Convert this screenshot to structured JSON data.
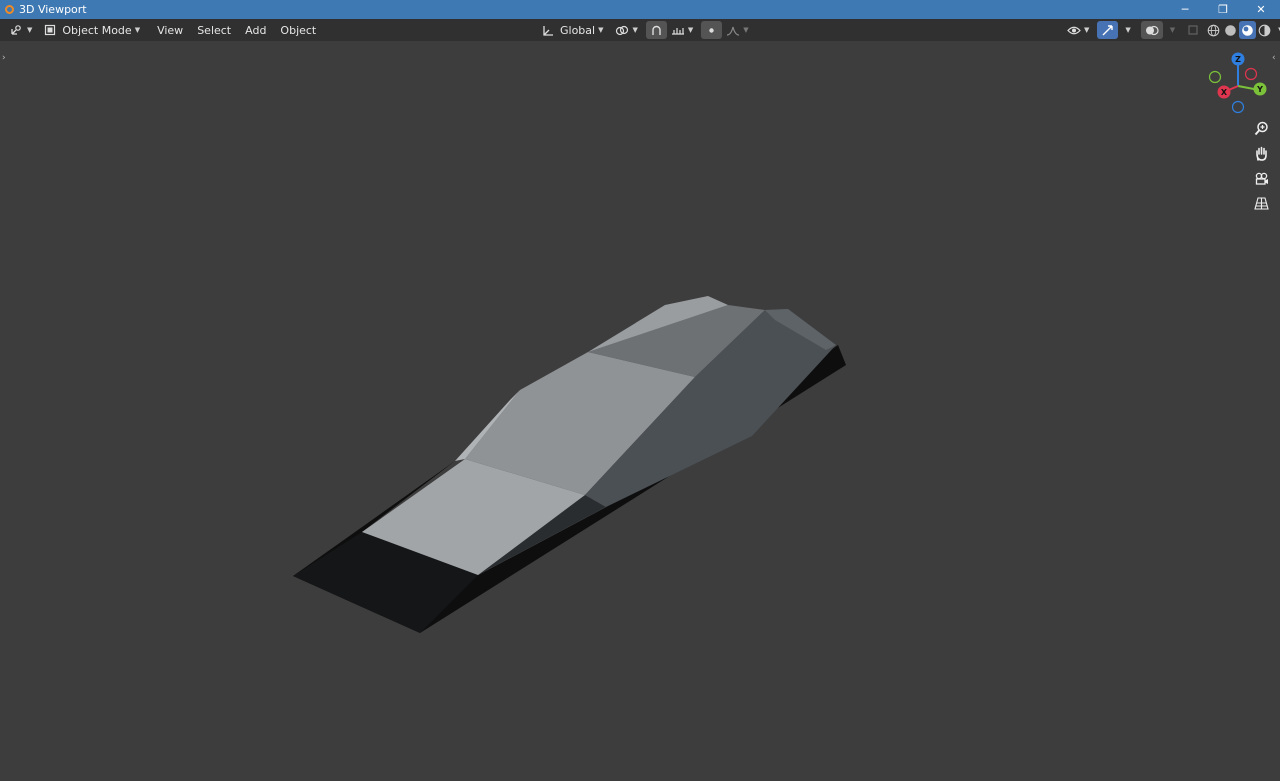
{
  "window": {
    "title": "3D Viewport",
    "minimize": "─",
    "restore": "❐",
    "close": "✕"
  },
  "header": {
    "mode_label": "Object Mode",
    "menus": [
      "View",
      "Select",
      "Add",
      "Object"
    ],
    "orientation_label": "Global"
  },
  "gizmo": {
    "x": "X",
    "y": "Y",
    "z": "Z"
  },
  "colors": {
    "titlebar": "#3f79b3",
    "header": "#303030",
    "viewport": "#3d3d3d",
    "accent": "#4772b3"
  }
}
